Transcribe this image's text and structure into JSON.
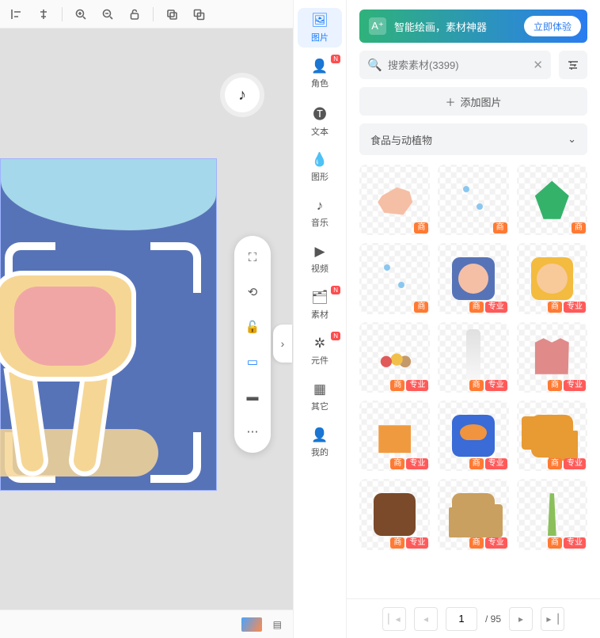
{
  "toolbar": {
    "icons": [
      "align-left",
      "align-center",
      "zoom-in",
      "zoom-out",
      "unlock",
      "sep",
      "copy",
      "paste"
    ]
  },
  "float_tools": [
    "fullscreen",
    "rotate",
    "lock",
    "screen",
    "layers",
    "more"
  ],
  "float_active_index": 3,
  "rail": [
    {
      "icon": "🖼",
      "label": "图片",
      "active": true,
      "new": false
    },
    {
      "icon": "👤",
      "label": "角色",
      "new": true
    },
    {
      "icon": "🅣",
      "label": "文本"
    },
    {
      "icon": "💧",
      "label": "图形"
    },
    {
      "icon": "♪",
      "label": "音乐"
    },
    {
      "icon": "▶",
      "label": "视频"
    },
    {
      "icon": "🗂",
      "label": "素材",
      "new": true
    },
    {
      "icon": "✲",
      "label": "元件",
      "new": true
    },
    {
      "icon": "▦",
      "label": "其它"
    },
    {
      "icon": "👤",
      "label": "我的"
    }
  ],
  "banner": {
    "text": "智能绘画，素材神器",
    "cta": "立即体验"
  },
  "search": {
    "placeholder": "搜索素材(3399)"
  },
  "add_image_label": "添加图片",
  "category_selected": "食品与动植物",
  "tags": {
    "shang": "商",
    "zhuanye": "专业"
  },
  "assets": [
    {
      "shape": "s-chicken",
      "tags": [
        "s"
      ]
    },
    {
      "shape": "s-dots",
      "tags": [
        "s"
      ]
    },
    {
      "shape": "s-leaf",
      "tags": [
        "s"
      ]
    },
    {
      "shape": "s-dots",
      "tags": [
        "s"
      ]
    },
    {
      "shape": "s-circle",
      "tags": [
        "s",
        "z"
      ]
    },
    {
      "shape": "s-disc",
      "tags": [
        "s",
        "z"
      ]
    },
    {
      "shape": "s-foods",
      "tags": [
        "s",
        "z"
      ]
    },
    {
      "shape": "s-bottle",
      "tags": [
        "s",
        "z"
      ]
    },
    {
      "shape": "s-meat",
      "tags": [
        "s",
        "z"
      ]
    },
    {
      "shape": "s-bag",
      "tags": [
        "s",
        "z"
      ]
    },
    {
      "shape": "s-bowl",
      "tags": [
        "s",
        "z"
      ]
    },
    {
      "shape": "s-flower",
      "tags": [
        "s",
        "z"
      ]
    },
    {
      "shape": "s-nut",
      "tags": [
        "s",
        "z"
      ]
    },
    {
      "shape": "s-potato",
      "tags": [
        "s",
        "z"
      ]
    },
    {
      "shape": "s-wheat",
      "tags": [
        "s",
        "z"
      ]
    }
  ],
  "pager": {
    "current": "1",
    "total": "/ 95"
  }
}
